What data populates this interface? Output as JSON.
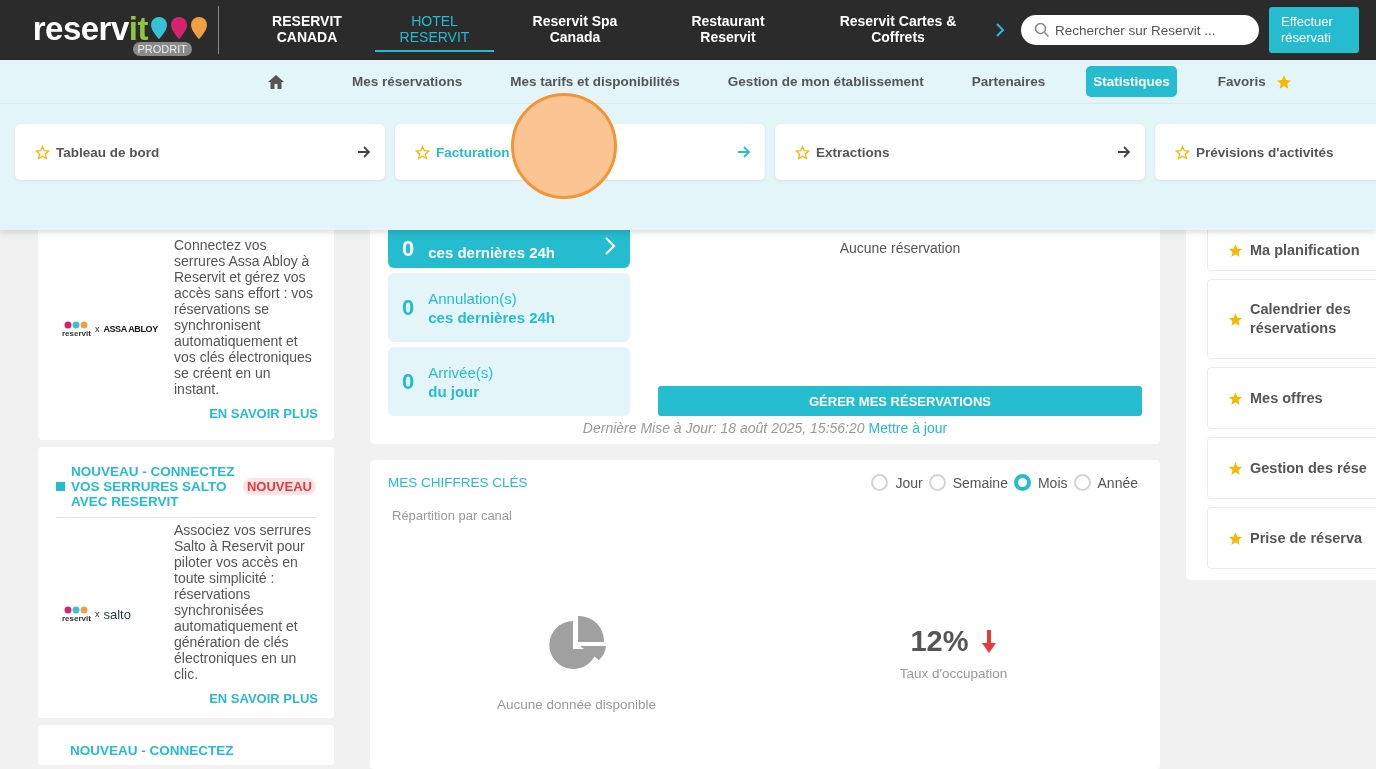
{
  "topbar": {
    "logo": {
      "word": "reserv",
      "accent": "it",
      "badge": "PRODRIT"
    },
    "nav": [
      {
        "label": "RESERVIT CANADA",
        "selected": false
      },
      {
        "label": "HOTEL RESERVIT",
        "selected": true
      },
      {
        "label": "Reservit Spa Canada",
        "selected": false
      },
      {
        "label": "Restaurant Reservit",
        "selected": false
      },
      {
        "label": "Reservit Cartes & Coffrets",
        "selected": false
      }
    ],
    "search": {
      "placeholder": "Rechercher sur Reservit ..."
    },
    "action_button": "Effectuer réservati"
  },
  "subnav": [
    {
      "kind": "home",
      "selected": false
    },
    {
      "kind": "link",
      "label": "Mes réservations",
      "selected": false
    },
    {
      "kind": "link",
      "label": "Mes tarifs et disponibilités",
      "selected": false
    },
    {
      "kind": "link",
      "label": "Gestion de mon établissement",
      "selected": false
    },
    {
      "kind": "link",
      "label": "Partenaires",
      "selected": false
    },
    {
      "kind": "link",
      "label": "Statistiques",
      "selected": true
    },
    {
      "kind": "favorites",
      "label": "Favoris",
      "selected": false
    }
  ],
  "dropdown": [
    {
      "label": "Tableau de bord",
      "selected": false,
      "arrow": true
    },
    {
      "label": "Facturation",
      "selected": true,
      "arrow": true
    },
    {
      "label": "Extractions",
      "selected": false,
      "arrow": true
    },
    {
      "label": "Prévisions d'activités",
      "selected": false,
      "arrow": false
    }
  ],
  "promos": [
    {
      "logo": {
        "brand": "reservit",
        "separator": "x",
        "partner": "ASSA ABLOY",
        "kind": "assa"
      },
      "text": "Connectez vos serrures Assa Abloy à Reservit et gérez vos accès sans effort : vos réservations se synchronisent automatiquement et vos clés électroniques se créent en un instant.",
      "link": "EN SAVOIR PLUS"
    },
    {
      "bullet": true,
      "title": "NOUVEAU - CONNECTEZ VOS SERRURES SALTO AVEC RESERVIT",
      "badge": "NOUVEAU",
      "logo": {
        "brand": "reservit",
        "separator": "x",
        "partner": "salto",
        "kind": "salto"
      },
      "text": "Associez vos serrures Salto à Reservit pour piloter vos accès en toute simplicité : réservations synchronisées automatiquement et génération de clés électroniques en un clic.",
      "link": "EN SAVOIR PLUS"
    },
    {
      "bullet": false,
      "title": "NOUVEAU - CONNECTEZ"
    }
  ],
  "reservations": {
    "tiles": [
      {
        "count": "0",
        "line2": "ces dernières 24h",
        "active": true
      },
      {
        "count": "0",
        "line1": "Annulation(s)",
        "line2": "ces dernières 24h",
        "active": false
      },
      {
        "count": "0",
        "line1": "Arrivée(s)",
        "line2": "du jour",
        "active": false
      }
    ],
    "empty": "Aucune réservation",
    "button": "GÉRER MES RÉSERVATIONS",
    "updated": "Dernière Mise à Jour: 18 août 2025, 15:56:20",
    "refresh_link": "Mettre à jour"
  },
  "key_figures": {
    "title": "MES CHIFFRES CLÉS",
    "periods": [
      {
        "label": "Jour",
        "selected": false
      },
      {
        "label": "Semaine",
        "selected": false
      },
      {
        "label": "Mois",
        "selected": true
      },
      {
        "label": "Année",
        "selected": false
      }
    ],
    "channel_title": "Répartition par canal",
    "no_data": "Aucune donnée disponible",
    "occupancy": {
      "value": "12%",
      "label": "Taux d'occupation"
    }
  },
  "favorites": [
    {
      "label": "Ma planification"
    },
    {
      "label": "Calendrier des réservations"
    },
    {
      "label": "Mes offres"
    },
    {
      "label": "Gestion des rése"
    },
    {
      "label": "Prise de réserva"
    }
  ]
}
